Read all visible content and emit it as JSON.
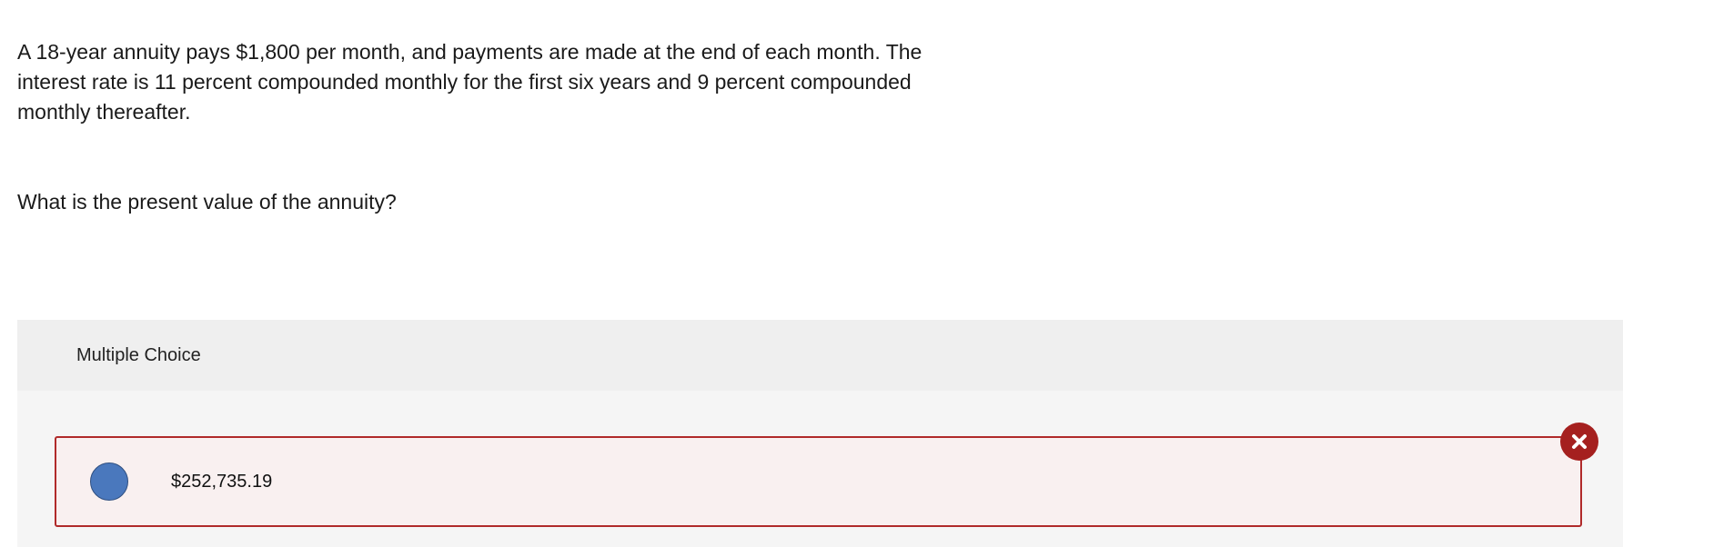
{
  "question": {
    "text": "A 18-year annuity pays $1,800 per month, and payments are made at the end of each month. The interest rate is 11 percent compounded monthly for the first six years and 9 percent compounded monthly thereafter.",
    "prompt": "What is the present value of the annuity?"
  },
  "multiple_choice": {
    "header": "Multiple Choice",
    "options": [
      {
        "label": "$252,735.19",
        "selected": true,
        "status": "incorrect"
      }
    ]
  },
  "colors": {
    "incorrect_border": "#b02a2a",
    "incorrect_badge": "#a5201f",
    "radio_selected": "#4a78bd"
  },
  "icons": {
    "incorrect_badge": "close-icon"
  }
}
